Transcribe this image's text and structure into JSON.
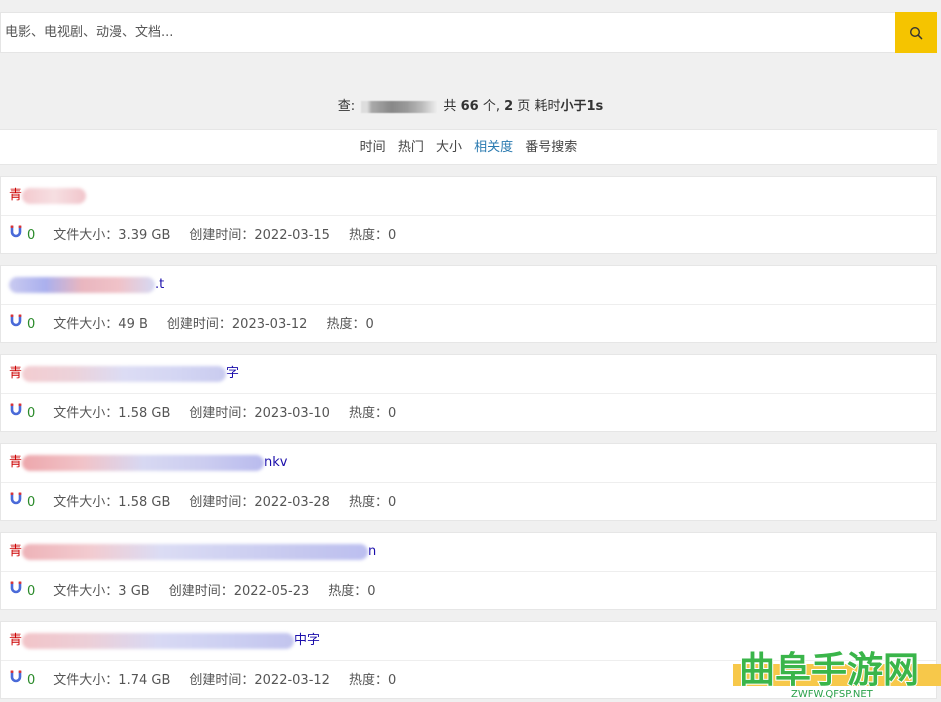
{
  "search": {
    "placeholder": "电影、电视剧、动漫、文档..."
  },
  "summary": {
    "prefix": "查:",
    "total_pre": "共",
    "total": "66",
    "unit1": "个,",
    "pages": "2",
    "unit2": "页",
    "time_label": "耗时",
    "time_value": "小于1s"
  },
  "sort": {
    "options": [
      "时间",
      "热门",
      "大小",
      "相关度",
      "番号搜索"
    ],
    "active": "相关度"
  },
  "labels": {
    "size": "文件大小：",
    "created": "创建时间：",
    "heat": "热度："
  },
  "results": [
    {
      "title_head": "青",
      "title_tail": "",
      "count": "0",
      "size": "3.39 GB",
      "created": "2022-03-15",
      "heat": "0"
    },
    {
      "title_head": "",
      "title_tail": ".t",
      "count": "0",
      "size": "49 B",
      "created": "2023-03-12",
      "heat": "0"
    },
    {
      "title_head": "青",
      "title_tail": "字",
      "count": "0",
      "size": "1.58 GB",
      "created": "2023-03-10",
      "heat": "0"
    },
    {
      "title_head": "青",
      "title_tail": "nkv",
      "count": "0",
      "size": "1.58 GB",
      "created": "2022-03-28",
      "heat": "0"
    },
    {
      "title_head": "青",
      "title_tail": "n",
      "count": "0",
      "size": "3 GB",
      "created": "2022-05-23",
      "heat": "0"
    },
    {
      "title_head": "青",
      "title_tail": "中字",
      "count": "0",
      "size": "1.74 GB",
      "created": "2022-03-12",
      "heat": "0"
    }
  ],
  "watermark": {
    "main": "曲阜手游网",
    "sub": "ZWFW.QFSP.NET"
  },
  "colors": {
    "accent": "#f5c400",
    "link": "#1a0dab",
    "active_sort": "#2a7ab0",
    "count": "#2a8a2a"
  }
}
